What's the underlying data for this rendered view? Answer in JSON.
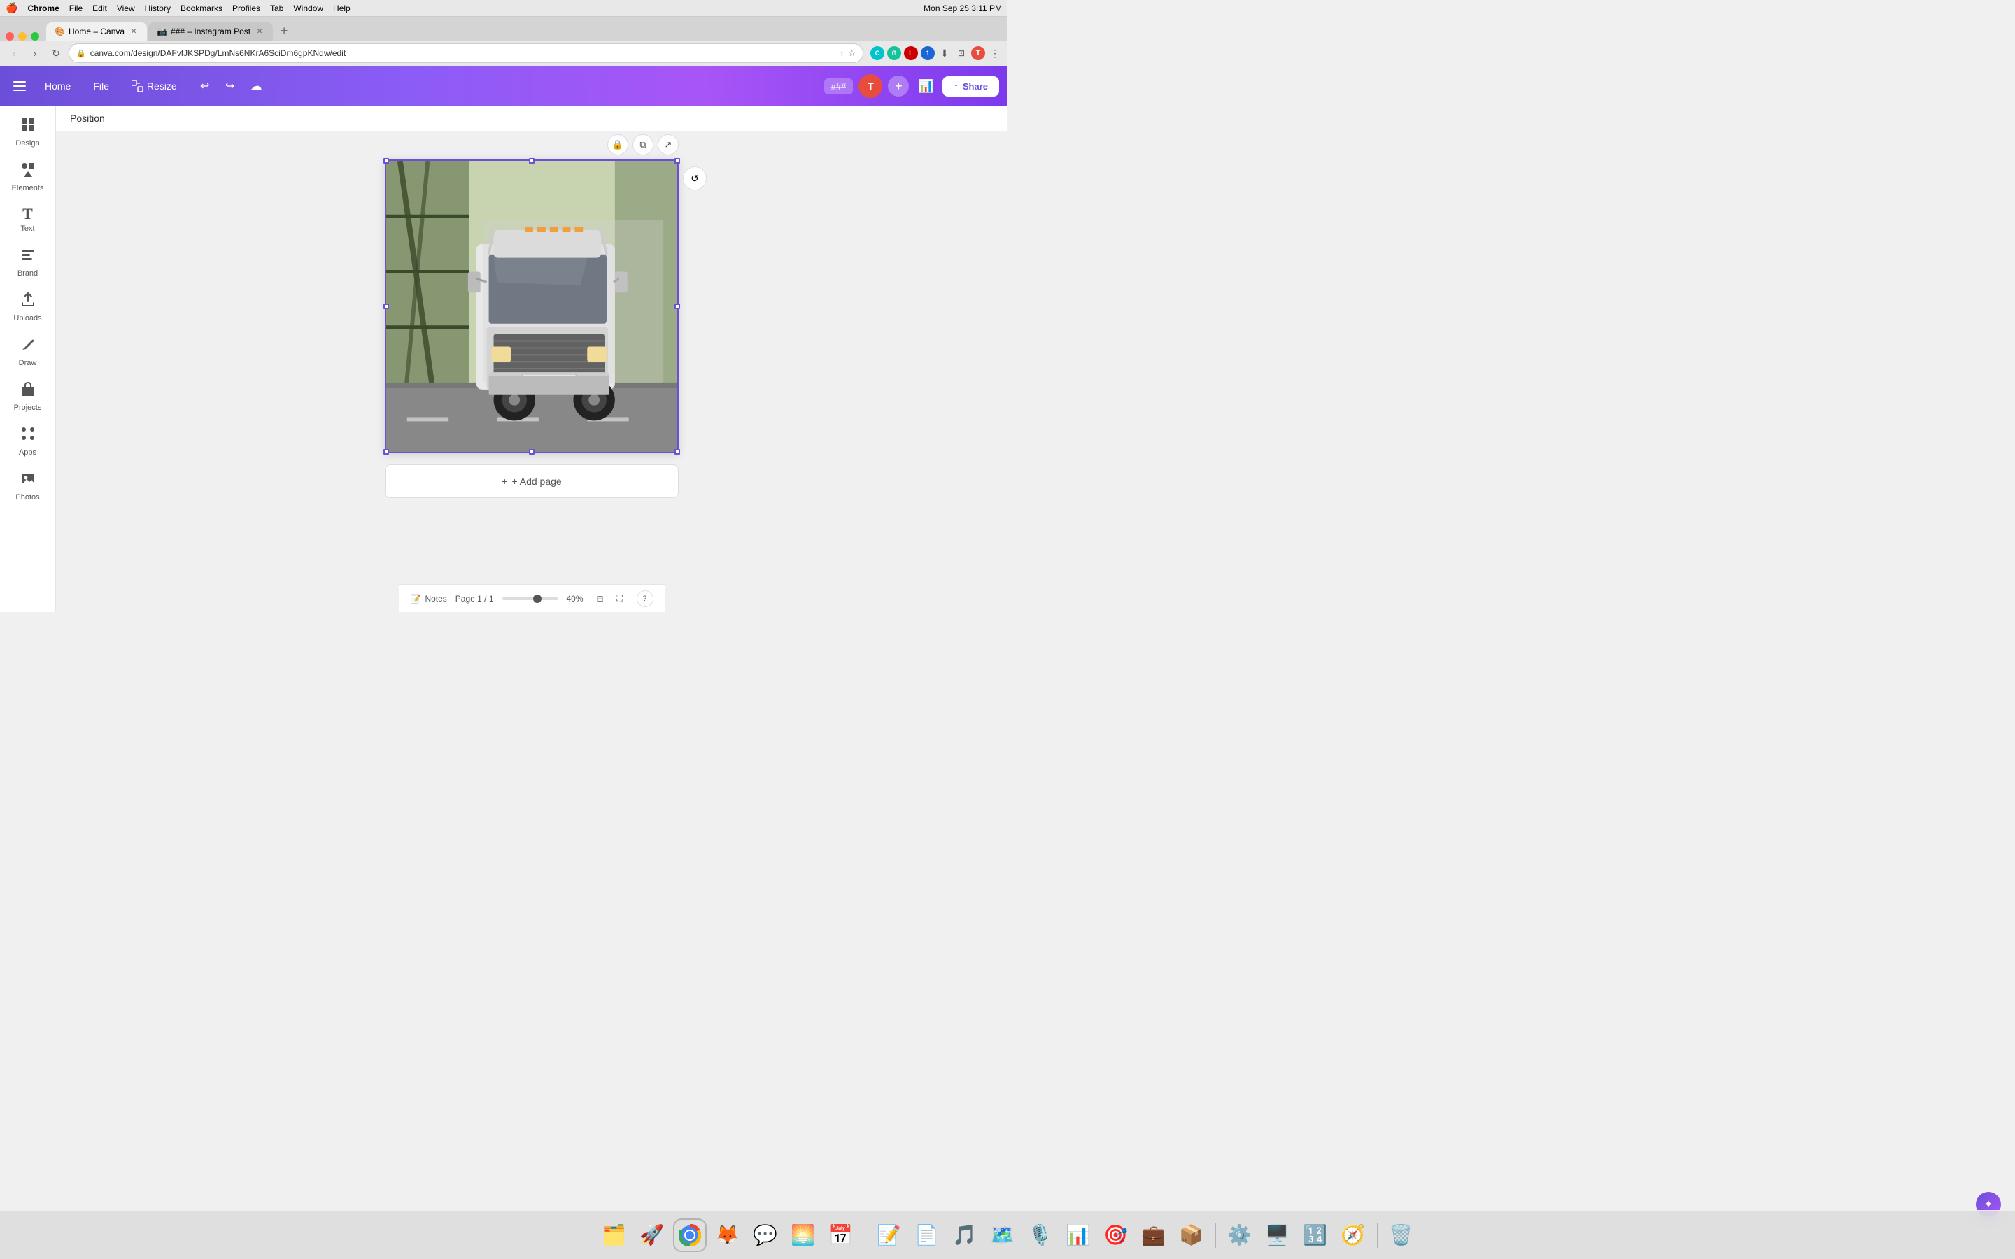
{
  "menubar": {
    "apple": "🍎",
    "app": "Chrome",
    "items": [
      "File",
      "Edit",
      "View",
      "History",
      "Bookmarks",
      "Profiles",
      "Tab",
      "Window",
      "Help"
    ],
    "time": "Mon Sep 25  3:11 PM"
  },
  "browser": {
    "tabs": [
      {
        "id": "tab1",
        "label": "Home – Canva",
        "active": true,
        "favicon": "🎨"
      },
      {
        "id": "tab2",
        "label": "### – Instagram Post",
        "active": false,
        "favicon": "📷"
      }
    ],
    "url": "canva.com/design/DAFvfJKSPDg/LmNs6NKrA6SciDm6gpKNdw/edit",
    "new_tab_label": "+"
  },
  "canva": {
    "topbar": {
      "menu_icon": "≡",
      "home_label": "Home",
      "file_label": "File",
      "resize_label": "Resize",
      "undo_label": "↩",
      "redo_label": "↪",
      "save_icon": "☁",
      "title_badge": "###",
      "avatar_initials": "T",
      "plus_label": "+",
      "analytics_icon": "📊",
      "share_label": "Share",
      "share_icon": "↑"
    },
    "sidebar": {
      "items": [
        {
          "id": "design",
          "icon": "✦",
          "label": "Design"
        },
        {
          "id": "elements",
          "icon": "◈",
          "label": "Elements"
        },
        {
          "id": "text",
          "icon": "T",
          "label": "Text"
        },
        {
          "id": "brand",
          "icon": "🏷",
          "label": "Brand"
        },
        {
          "id": "uploads",
          "icon": "↑",
          "label": "Uploads"
        },
        {
          "id": "draw",
          "icon": "✏",
          "label": "Draw"
        },
        {
          "id": "projects",
          "icon": "📁",
          "label": "Projects"
        },
        {
          "id": "apps",
          "icon": "⊞",
          "label": "Apps"
        },
        {
          "id": "photos",
          "icon": "🖼",
          "label": "Photos"
        }
      ]
    },
    "position_header": "Position",
    "canvas": {
      "page_num": "1",
      "page_total": "1",
      "zoom_pct": "40%",
      "add_page_label": "+ Add page"
    },
    "bottombar": {
      "notes_label": "Notes",
      "page_label": "Page 1 / 1",
      "zoom_pct": "40%"
    },
    "canvas_controls": [
      {
        "id": "lock",
        "icon": "🔒"
      },
      {
        "id": "copy",
        "icon": "⧉"
      },
      {
        "id": "share",
        "icon": "↗"
      }
    ],
    "refresh_icon": "↺"
  },
  "dock": {
    "items": [
      {
        "id": "finder",
        "emoji": "🗂️"
      },
      {
        "id": "launchpad",
        "emoji": "🚀"
      },
      {
        "id": "chrome",
        "emoji": "🌐"
      },
      {
        "id": "firefox",
        "emoji": "🦊"
      },
      {
        "id": "messages",
        "emoji": "💬"
      },
      {
        "id": "photos",
        "emoji": "🌅"
      },
      {
        "id": "calendar",
        "emoji": "📅"
      },
      {
        "id": "word",
        "emoji": "📝"
      },
      {
        "id": "acrobat",
        "emoji": "📄"
      },
      {
        "id": "music",
        "emoji": "🎵"
      },
      {
        "id": "maps",
        "emoji": "🗺️"
      },
      {
        "id": "podcasts",
        "emoji": "🎙️"
      },
      {
        "id": "slack",
        "emoji": "💼"
      },
      {
        "id": "appstore",
        "emoji": "📦"
      },
      {
        "id": "settings",
        "emoji": "⚙️"
      },
      {
        "id": "iterm",
        "emoji": "🖥️"
      },
      {
        "id": "calculator",
        "emoji": "🔢"
      },
      {
        "id": "safari",
        "emoji": "🧭"
      },
      {
        "id": "trash",
        "emoji": "🗑️"
      }
    ]
  }
}
